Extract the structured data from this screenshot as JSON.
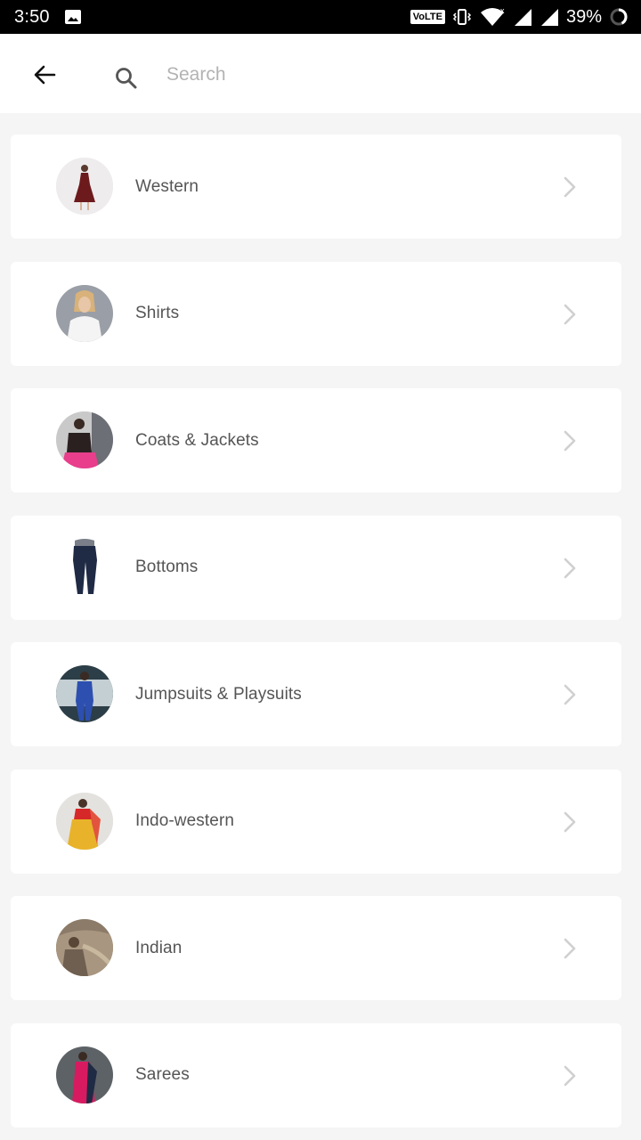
{
  "status_bar": {
    "time": "3:50",
    "volte": "VoLTE",
    "battery": "39%",
    "icons": [
      "image-icon",
      "vibrate-icon",
      "wifi-icon",
      "signal-icon",
      "signal-icon-2",
      "battery-circle-icon"
    ]
  },
  "search": {
    "placeholder": "Search",
    "value": ""
  },
  "categories": [
    {
      "label": "Western",
      "thumb": "western-dress-thumbnail"
    },
    {
      "label": "Shirts",
      "thumb": "shirt-thumbnail"
    },
    {
      "label": "Coats & Jackets",
      "thumb": "coat-thumbnail"
    },
    {
      "label": "Bottoms",
      "thumb": "jeans-thumbnail"
    },
    {
      "label": "Jumpsuits & Playsuits",
      "thumb": "jumpsuit-thumbnail"
    },
    {
      "label": "Indo-western",
      "thumb": "indo-western-thumbnail"
    },
    {
      "label": "Indian",
      "thumb": "indian-thumbnail"
    },
    {
      "label": "Sarees",
      "thumb": "saree-thumbnail"
    }
  ],
  "colors": {
    "status_bar_bg": "#000000",
    "page_bg": "#f5f5f5",
    "card_bg": "#ffffff",
    "label_text": "#555555",
    "placeholder_text": "#b3b3b3",
    "chevron": "#d0d0d0"
  }
}
